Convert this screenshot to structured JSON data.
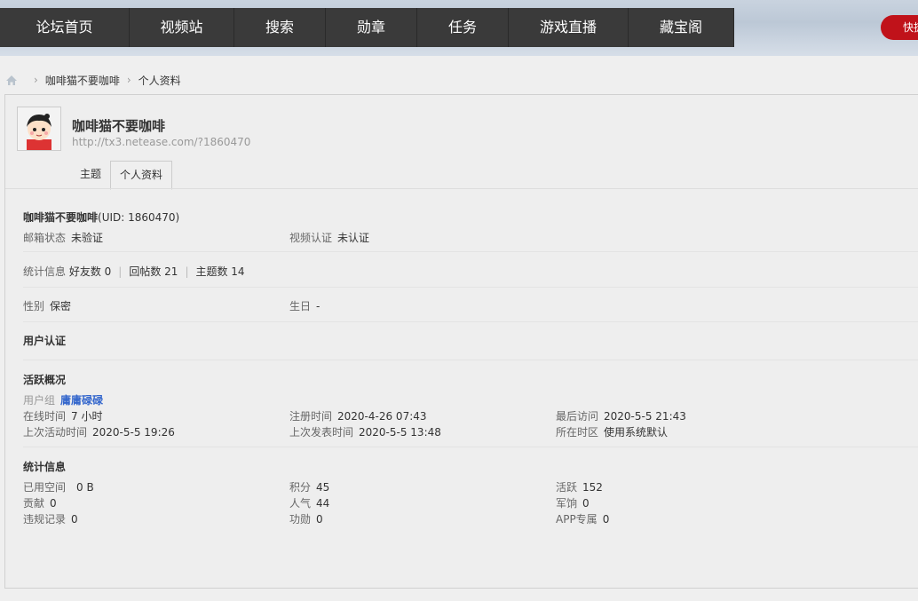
{
  "nav": [
    "论坛首页",
    "视频站",
    "搜索",
    "勋章",
    "任务",
    "游戏直播",
    "藏宝阁"
  ],
  "quick_label": "快捷",
  "breadcrumb": {
    "user": "咖啡猫不要咖啡",
    "page": "个人资料"
  },
  "profile": {
    "name": "咖啡猫不要咖啡",
    "url": "http://tx3.netease.com/?1860470",
    "tabs": [
      "主题",
      "个人资料"
    ],
    "uid_line": "(UID: 1860470)",
    "email_label": "邮箱状态",
    "email_value": "未验证",
    "video_label": "视频认证",
    "video_value": "未认证",
    "stats_label": "统计信息",
    "friends": "好友数 0",
    "replies": "回帖数 21",
    "threads": "主题数 14",
    "gender_label": "性别",
    "gender_value": "保密",
    "birthday_label": "生日",
    "birthday_value": "-",
    "user_cert": "用户认证",
    "activity_title": "活跃概况",
    "group_label": "用户组",
    "group_value": "庸庸碌碌",
    "online_label": "在线时间",
    "online_value": "7 小时",
    "reg_label": "注册时间",
    "reg_value": "2020-4-26 07:43",
    "last_visit_label": "最后访问",
    "last_visit_value": "2020-5-5 21:43",
    "last_active_label": "上次活动时间",
    "last_active_value": "2020-5-5 19:26",
    "last_post_label": "上次发表时间",
    "last_post_value": "2020-5-5 13:48",
    "tz_label": "所在时区",
    "tz_value": "使用系统默认",
    "statinfo_title": "统计信息",
    "space_label": "已用空间",
    "space_value": "0 B",
    "points_label": "积分",
    "points_value": "45",
    "active_label": "活跃",
    "active_value": "152",
    "contrib_label": "贡献",
    "contrib_value": "0",
    "pop_label": "人气",
    "pop_value": "44",
    "salary_label": "军饷",
    "salary_value": "0",
    "violation_label": "违规记录",
    "violation_value": "0",
    "merit_label": "功勋",
    "merit_value": "0",
    "app_label": "APP专属",
    "app_value": "0"
  },
  "colors": {
    "nav_bg": "#3a3a3a",
    "accent_red": "#c0121a",
    "link_blue": "#3366cc"
  }
}
